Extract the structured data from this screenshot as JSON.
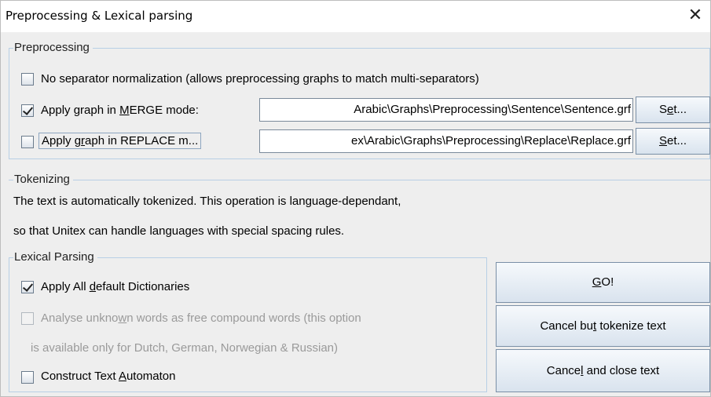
{
  "window": {
    "title": "Preprocessing & Lexical parsing"
  },
  "preprocessing": {
    "title": "Preprocessing",
    "no_sep_label": "No separator normalization (allows preprocessing graphs to match multi-separators)",
    "merge": {
      "label_pre": "Apply graph in ",
      "label_ul": "M",
      "label_post": "ERGE mode:",
      "checked": true,
      "path": "Arabic\\Graphs\\Preprocessing\\Sentence\\Sentence.grf",
      "set_pre": "S",
      "set_ul": "e",
      "set_post": "t..."
    },
    "replace": {
      "label_pre": "Apply g",
      "label_ul": "r",
      "label_post": "aph in REPLACE m...",
      "checked": false,
      "path": "ex\\Arabic\\Graphs\\Preprocessing\\Replace\\Replace.grf",
      "set_pre": "",
      "set_ul": "S",
      "set_post": "et..."
    }
  },
  "tokenizing": {
    "title": "Tokenizing",
    "line1": "The text is automatically tokenized. This operation is language-dependant,",
    "line2": "so that Unitex can handle languages with special spacing rules."
  },
  "lexical": {
    "title": "Lexical Parsing",
    "apply_dict": {
      "pre": "Apply All ",
      "ul": "d",
      "post": "efault Dictionaries",
      "checked": true
    },
    "analyse": {
      "pre": "Analyse unkno",
      "ul": "w",
      "post": "n words as free compound words (this option",
      "line2": "is available only for Dutch, German, Norwegian & Russian)",
      "checked": false,
      "enabled": false
    },
    "automaton": {
      "pre": "Construct Text ",
      "ul": "A",
      "post": "utomaton",
      "checked": false
    }
  },
  "buttons": {
    "go": {
      "ul": "G",
      "post": "O!"
    },
    "cancel_tokenize": {
      "pre": "Cancel bu",
      "ul": "t",
      "post": " tokenize text"
    },
    "cancel_close": {
      "pre": "Cance",
      "ul": "l",
      "post": " and close text"
    }
  }
}
